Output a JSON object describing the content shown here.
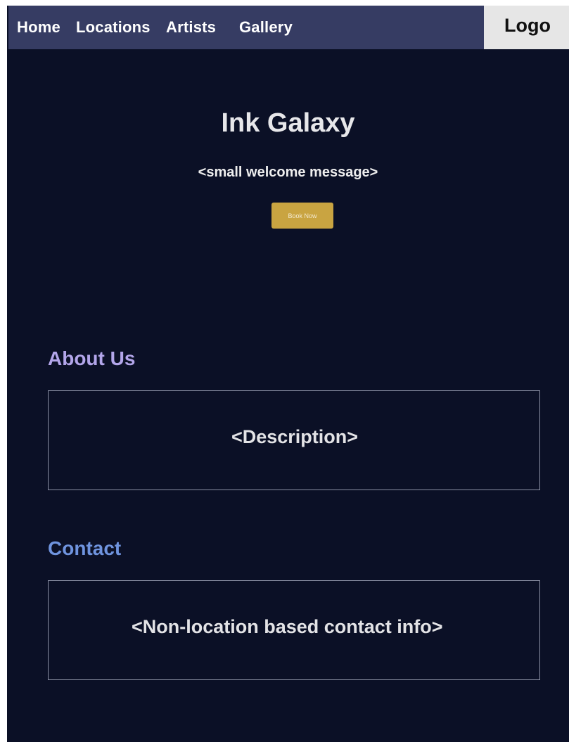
{
  "nav": {
    "items": [
      {
        "label": "Home"
      },
      {
        "label": "Locations"
      },
      {
        "label": "Artists"
      },
      {
        "label": "Gallery"
      }
    ],
    "logo": "Logo"
  },
  "hero": {
    "title": "Ink Galaxy",
    "subtitle": "<small welcome message>",
    "button_label": "Book Now"
  },
  "about": {
    "heading": "About Us",
    "body": "<Description>"
  },
  "contact": {
    "heading": "Contact",
    "body": "<Non-location based contact info>"
  },
  "colors": {
    "page_background": "#0b1026",
    "nav_background": "#363c63",
    "logo_background": "#e6e6e6",
    "button": "#c9a441",
    "about_heading": "#b3a6ea",
    "contact_heading": "#6f94df"
  }
}
